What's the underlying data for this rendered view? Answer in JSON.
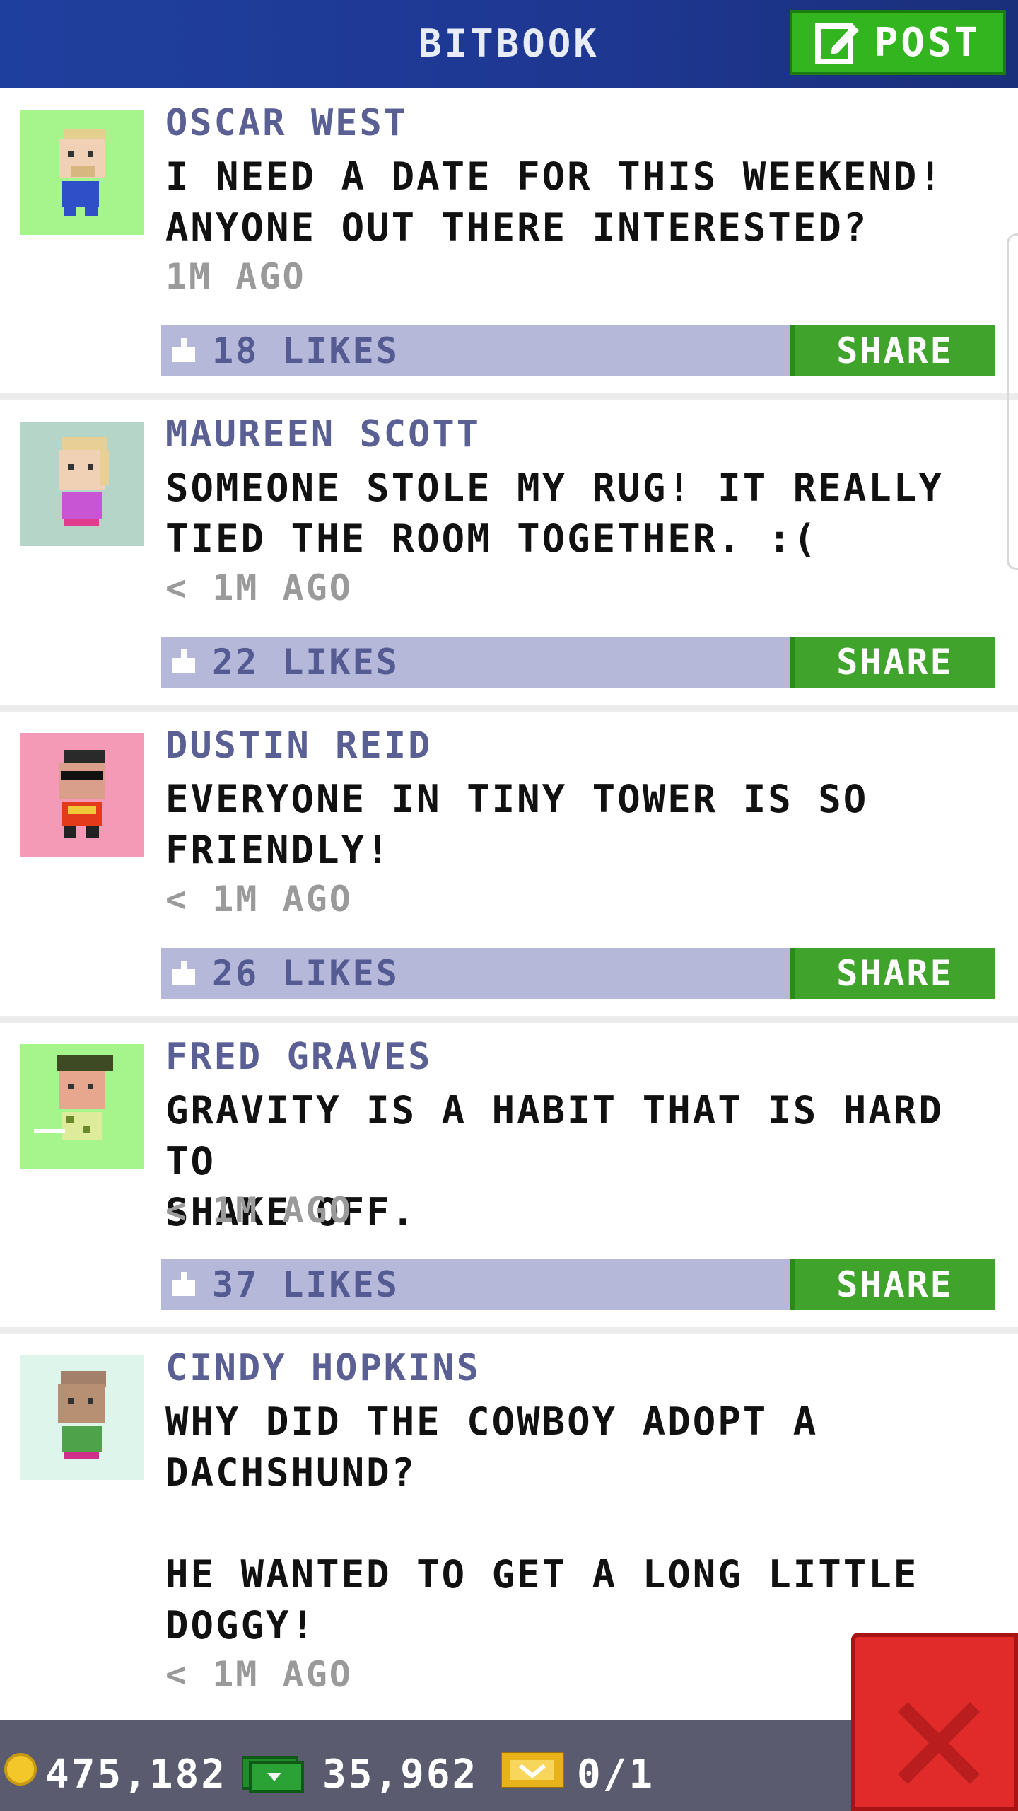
{
  "header": {
    "title": "BITBOOK",
    "post_label": "POST"
  },
  "posts": [
    {
      "name": "OSCAR WEST",
      "message": "I NEED A DATE FOR THIS WEEKEND!\nANYONE OUT THERE INTERESTED?",
      "time": "1M AGO",
      "likes": "18 LIKES",
      "share": "SHARE",
      "avatar_bg": "#a5f58c"
    },
    {
      "name": "MAUREEN SCOTT",
      "message": "SOMEONE STOLE MY RUG! IT REALLY\nTIED THE ROOM TOGETHER. :(",
      "time": "< 1M AGO",
      "likes": "22 LIKES",
      "share": "SHARE",
      "avatar_bg": "#b5d5c9"
    },
    {
      "name": "DUSTIN REID",
      "message": "EVERYONE IN TINY TOWER IS SO\nFRIENDLY!",
      "time": "< 1M AGO",
      "likes": "26 LIKES",
      "share": "SHARE",
      "avatar_bg": "#f59ab6"
    },
    {
      "name": "FRED GRAVES",
      "message": "GRAVITY IS A HABIT THAT IS HARD TO\nSHAKE OFF.",
      "time": "< 1M AGO",
      "likes": "37 LIKES",
      "share": "SHARE",
      "avatar_bg": "#a5f58c"
    },
    {
      "name": "CINDY HOPKINS",
      "message": "WHY DID THE COWBOY ADOPT A\nDACHSHUND?\n\nHE WANTED TO GET A LONG LITTLE\nDOGGY!",
      "time": "< 1M AGO",
      "avatar_bg": "#ddf5ea"
    }
  ],
  "status": {
    "coins": "475,182",
    "bux": "35,962",
    "tickets": "0/1"
  },
  "colors": {
    "header": "#1f3f9e",
    "post_button": "#33b51f",
    "like_bar": "#b5b8d8",
    "share": "#3fa32c",
    "close": "#e12b2b"
  },
  "icons": {
    "post": "edit-icon",
    "like": "thumb-icon",
    "coin": "coin-icon",
    "bux": "bux-icon",
    "ticket": "ticket-icon",
    "close": "close-icon"
  }
}
